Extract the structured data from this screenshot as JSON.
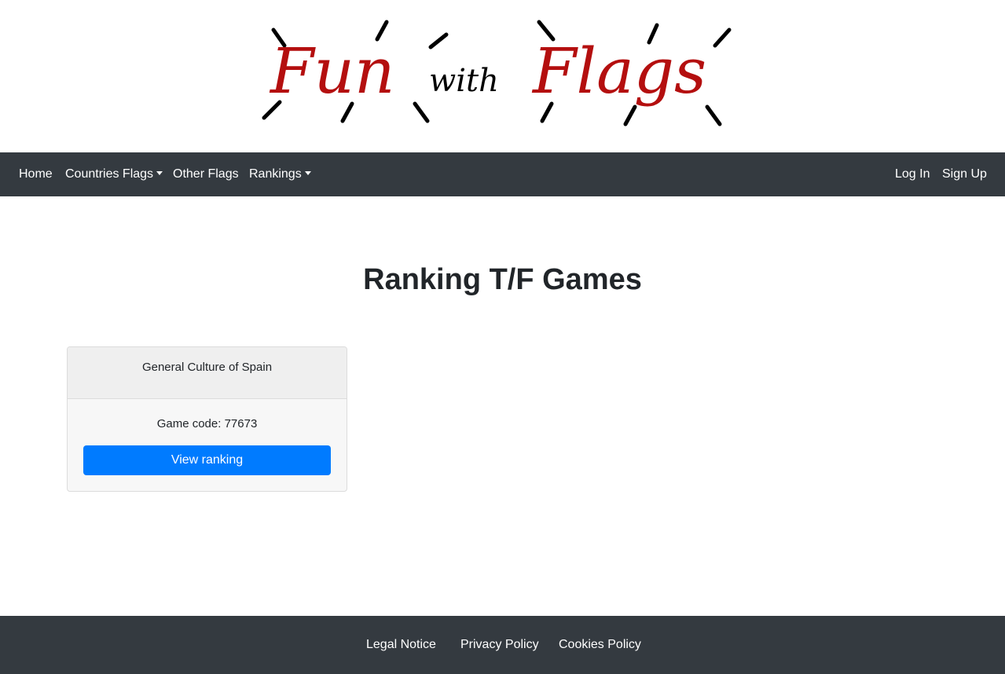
{
  "logo": {
    "word_fun": "Fun",
    "word_with": "with",
    "word_flags": "Flags",
    "text_color": "#b40f0f",
    "ray_color": "#000000"
  },
  "navbar": {
    "background": "#343a40",
    "left_items": [
      {
        "label": "Home",
        "dropdown": false
      },
      {
        "label": "Countries Flags",
        "dropdown": true
      },
      {
        "label": "Other Flags",
        "dropdown": false
      },
      {
        "label": "Rankings",
        "dropdown": true
      }
    ],
    "right_items": [
      {
        "label": "Log In"
      },
      {
        "label": "Sign Up"
      }
    ]
  },
  "main": {
    "title": "Ranking T/F Games",
    "cards": [
      {
        "header": "General Culture of Spain",
        "code_text": "Game code: 77673",
        "button_label": "View ranking",
        "button_color": "#007bff"
      }
    ]
  },
  "footer": {
    "links": [
      {
        "label": "Legal Notice"
      },
      {
        "label": "Privacy Policy"
      },
      {
        "label": "Cookies Policy"
      }
    ]
  }
}
